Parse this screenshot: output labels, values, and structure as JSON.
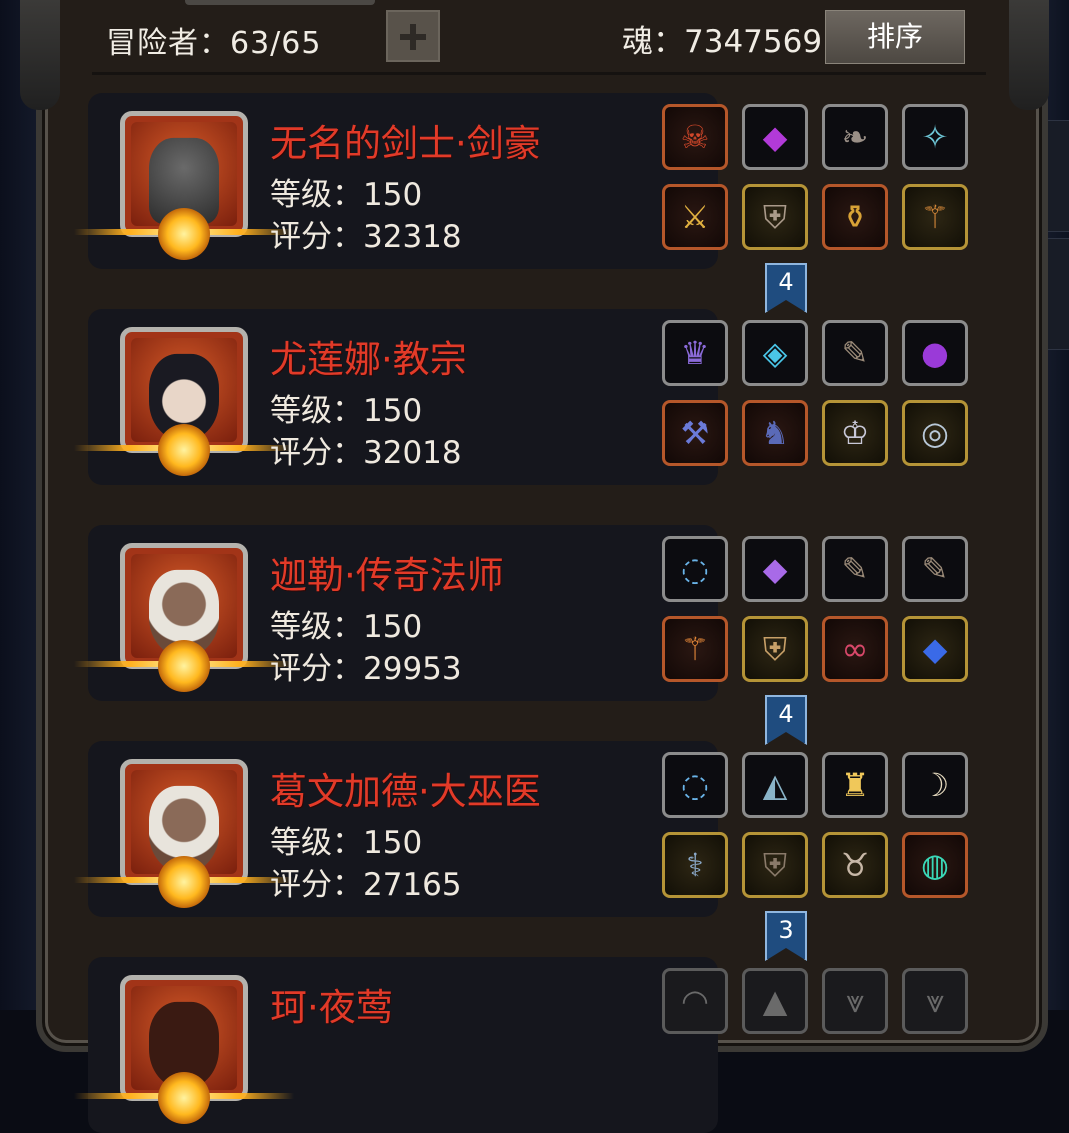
{
  "header": {
    "adventurers_label": "冒险者：63/65",
    "soul_label": "魂：7347569",
    "sort_label": "排序"
  },
  "heroes": [
    {
      "name": "无名的剑士·剑豪",
      "level_label": "等级：150",
      "score_label": "评分：32318",
      "equipment": [
        {
          "icon": "demon-helm-icon",
          "rarity": "orange",
          "glyph": "☠",
          "color": "#d0472a"
        },
        {
          "icon": "purple-gem-icon",
          "rarity": "grey",
          "glyph": "◆",
          "color": "#b23ad8"
        },
        {
          "icon": "feather-icon",
          "rarity": "grey",
          "glyph": "❧",
          "color": "#9a8f86"
        },
        {
          "icon": "amulet-icon",
          "rarity": "grey",
          "glyph": "✧",
          "color": "#6fc8d8"
        },
        {
          "icon": "sword-icon",
          "rarity": "orange",
          "glyph": "⚔",
          "color": "#e0b040"
        },
        {
          "icon": "chest-armor-icon",
          "rarity": "gold",
          "glyph": "⛨",
          "color": "#aa9a8a"
        },
        {
          "icon": "potion-icon",
          "rarity": "orange",
          "glyph": "⚱",
          "color": "#d8a236"
        },
        {
          "icon": "staff-icon",
          "rarity": "gold",
          "glyph": "⚚",
          "color": "#d88a3a"
        }
      ],
      "upgrade_badge": "4"
    },
    {
      "name": "尤莲娜·教宗",
      "level_label": "等级：150",
      "score_label": "评分：32018",
      "equipment": [
        {
          "icon": "dark-crown-icon",
          "rarity": "grey",
          "glyph": "♛",
          "color": "#8a6ad8"
        },
        {
          "icon": "blue-crystal-icon",
          "rarity": "grey",
          "glyph": "◈",
          "color": "#4ac6e8"
        },
        {
          "icon": "bone-shard-icon",
          "rarity": "grey",
          "glyph": "✎",
          "color": "#9a8a78"
        },
        {
          "icon": "purple-orb-icon",
          "rarity": "grey",
          "glyph": "●",
          "color": "#9a3ad8"
        },
        {
          "icon": "axe-icon",
          "rarity": "orange",
          "glyph": "⚒",
          "color": "#6a7ad8"
        },
        {
          "icon": "robe-icon",
          "rarity": "orange",
          "glyph": "♞",
          "color": "#5a6ab8"
        },
        {
          "icon": "silver-crown-icon",
          "rarity": "gold",
          "glyph": "♔",
          "color": "#c8c8d8"
        },
        {
          "icon": "ring-icon",
          "rarity": "gold",
          "glyph": "◎",
          "color": "#b8c8d8"
        }
      ],
      "upgrade_badge": ""
    },
    {
      "name": "迦勒·传奇法师",
      "level_label": "等级：150",
      "score_label": "评分：29953",
      "equipment": [
        {
          "icon": "blue-halo-icon",
          "rarity": "grey",
          "glyph": "◌",
          "color": "#6ab4e8"
        },
        {
          "icon": "purple-gem-icon",
          "rarity": "grey",
          "glyph": "◆",
          "color": "#a86ae8"
        },
        {
          "icon": "bone-shard-icon",
          "rarity": "grey",
          "glyph": "✎",
          "color": "#9a8a78"
        },
        {
          "icon": "bone-shard-icon",
          "rarity": "grey",
          "glyph": "✎",
          "color": "#9a8a78"
        },
        {
          "icon": "fire-staff-icon",
          "rarity": "orange",
          "glyph": "⚚",
          "color": "#e88a3a"
        },
        {
          "icon": "chest-armor-icon",
          "rarity": "gold",
          "glyph": "⛨",
          "color": "#c8a068"
        },
        {
          "icon": "serpent-amulet-icon",
          "rarity": "orange",
          "glyph": "∞",
          "color": "#d8486a"
        },
        {
          "icon": "sapphire-icon",
          "rarity": "gold",
          "glyph": "◆",
          "color": "#3a6ae8"
        }
      ],
      "upgrade_badge": "4"
    },
    {
      "name": "葛文加德·大巫医",
      "level_label": "等级：150",
      "score_label": "评分：27165",
      "equipment": [
        {
          "icon": "blue-halo-icon",
          "rarity": "grey",
          "glyph": "◌",
          "color": "#6ab4e8"
        },
        {
          "icon": "rock-icon",
          "rarity": "grey",
          "glyph": "◭",
          "color": "#8ab4c8"
        },
        {
          "icon": "lantern-icon",
          "rarity": "grey",
          "glyph": "♜",
          "color": "#f0c85a"
        },
        {
          "icon": "horn-icon",
          "rarity": "grey",
          "glyph": "☽",
          "color": "#e8dcc0"
        },
        {
          "icon": "serpent-staff-icon",
          "rarity": "gold",
          "glyph": "⚕",
          "color": "#8aa8c8"
        },
        {
          "icon": "leather-armor-icon",
          "rarity": "gold",
          "glyph": "⛨",
          "color": "#8a7a6a"
        },
        {
          "icon": "horned-charm-icon",
          "rarity": "gold",
          "glyph": "♉",
          "color": "#c8b8a8"
        },
        {
          "icon": "emerald-ring-icon",
          "rarity": "orange",
          "glyph": "◍",
          "color": "#3ad8b8"
        }
      ],
      "upgrade_badge": "3"
    },
    {
      "name": "珂·夜莺",
      "level_label": "",
      "score_label": "",
      "equipment": [
        {
          "icon": "empty-slot-icon",
          "rarity": "dim",
          "glyph": "◠",
          "color": "#6a6a6a"
        },
        {
          "icon": "empty-slot-icon",
          "rarity": "dim",
          "glyph": "▲",
          "color": "#6a6a6a"
        },
        {
          "icon": "empty-slot-icon",
          "rarity": "dim",
          "glyph": "⩔",
          "color": "#6a6a6a"
        },
        {
          "icon": "empty-slot-icon",
          "rarity": "dim",
          "glyph": "⩔",
          "color": "#6a6a6a"
        }
      ],
      "upgrade_badge": ""
    }
  ],
  "colors": {
    "hero_name": "#e23a28",
    "text": "#efe9df",
    "badge": "#1f4c7f"
  }
}
